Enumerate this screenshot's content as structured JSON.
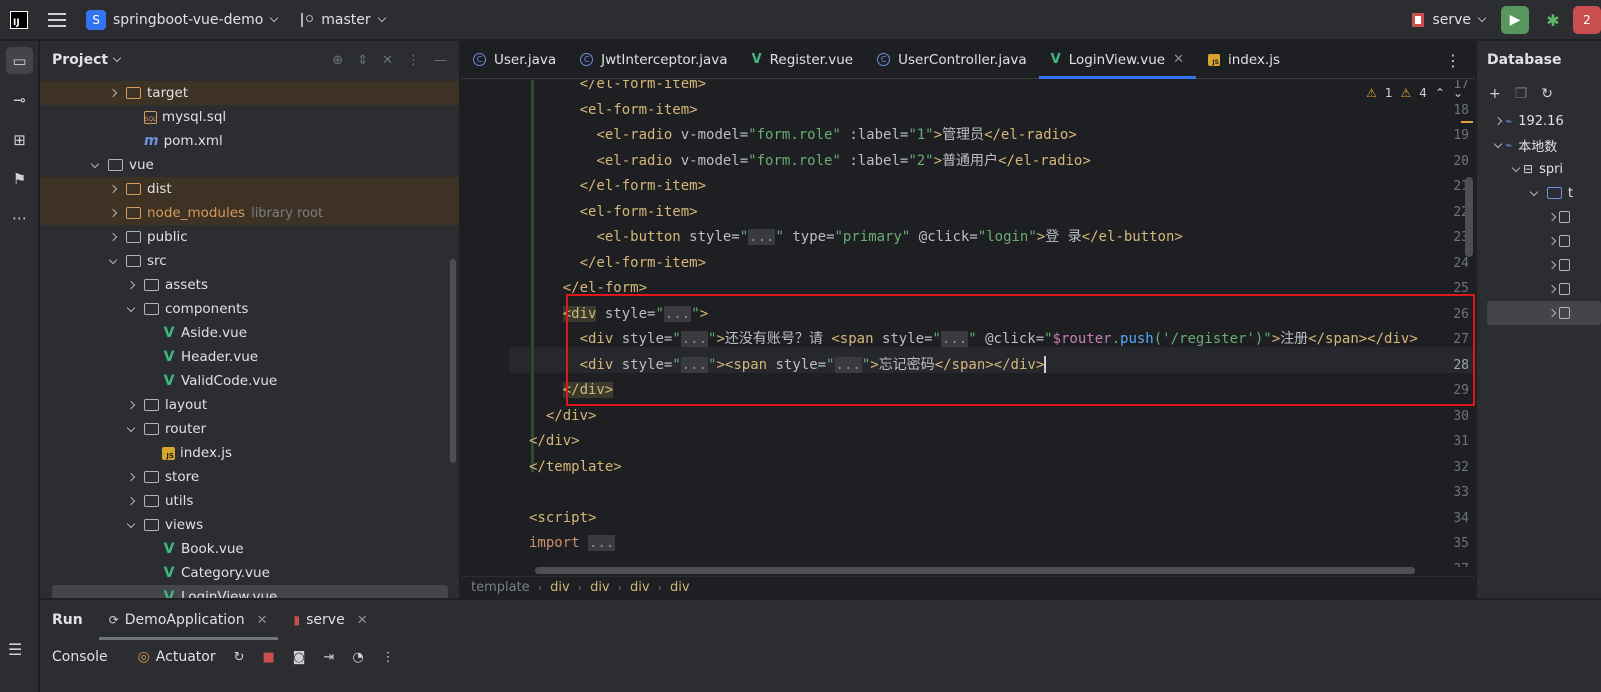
{
  "titlebar": {
    "logo_text": "IJ",
    "project_badge": "S",
    "project_name": "springboot-vue-demo",
    "branch": "master",
    "run_config": "serve",
    "run_icon": "▶",
    "debug_icon": "✱",
    "stop_badge": "2"
  },
  "toolstrip": {
    "icons": [
      "folder-icon",
      "commit-icon",
      "structure-icon",
      "bookmark-icon",
      "more-icon"
    ]
  },
  "project": {
    "title": "Project",
    "tree": [
      {
        "label": "target",
        "indent": 1,
        "kind": "folder-orange",
        "arrow": "closed",
        "excluded": true
      },
      {
        "label": "mysql.sql",
        "indent": 2,
        "kind": "sql",
        "arrow": "none",
        "excluded": false
      },
      {
        "label": "pom.xml",
        "indent": 2,
        "kind": "maven",
        "arrow": "none",
        "excluded": false
      },
      {
        "label": "vue",
        "indent": 0,
        "kind": "folder",
        "arrow": "open",
        "excluded": false
      },
      {
        "label": "dist",
        "indent": 1,
        "kind": "folder-orange",
        "arrow": "closed",
        "excluded": true
      },
      {
        "label": "node_modules",
        "extra": "library root",
        "indent": 1,
        "kind": "folder-orange",
        "arrow": "closed",
        "excluded": true,
        "dim": true
      },
      {
        "label": "public",
        "indent": 1,
        "kind": "folder",
        "arrow": "closed",
        "excluded": false
      },
      {
        "label": "src",
        "indent": 1,
        "kind": "folder",
        "arrow": "open",
        "excluded": false
      },
      {
        "label": "assets",
        "indent": 2,
        "kind": "folder",
        "arrow": "closed",
        "excluded": false
      },
      {
        "label": "components",
        "indent": 2,
        "kind": "folder",
        "arrow": "open",
        "excluded": false
      },
      {
        "label": "Aside.vue",
        "indent": 3,
        "kind": "vue",
        "arrow": "none",
        "excluded": false
      },
      {
        "label": "Header.vue",
        "indent": 3,
        "kind": "vue",
        "arrow": "none",
        "excluded": false
      },
      {
        "label": "ValidCode.vue",
        "indent": 3,
        "kind": "vue",
        "arrow": "none",
        "excluded": false
      },
      {
        "label": "layout",
        "indent": 2,
        "kind": "folder",
        "arrow": "closed",
        "excluded": false
      },
      {
        "label": "router",
        "indent": 2,
        "kind": "folder",
        "arrow": "open",
        "excluded": false
      },
      {
        "label": "index.js",
        "indent": 3,
        "kind": "js",
        "arrow": "none",
        "excluded": false
      },
      {
        "label": "store",
        "indent": 2,
        "kind": "folder",
        "arrow": "closed",
        "excluded": false
      },
      {
        "label": "utils",
        "indent": 2,
        "kind": "folder",
        "arrow": "closed",
        "excluded": false
      },
      {
        "label": "views",
        "indent": 2,
        "kind": "folder",
        "arrow": "open",
        "excluded": false
      },
      {
        "label": "Book.vue",
        "indent": 3,
        "kind": "vue",
        "arrow": "none",
        "excluded": false
      },
      {
        "label": "Category.vue",
        "indent": 3,
        "kind": "vue",
        "arrow": "none",
        "excluded": false
      },
      {
        "label": "LoginView.vue",
        "indent": 3,
        "kind": "vue",
        "arrow": "none",
        "excluded": false,
        "selected": true
      }
    ]
  },
  "editor": {
    "tabs": [
      {
        "label": "User.java",
        "icon": "class",
        "active": false
      },
      {
        "label": "JwtInterceptor.java",
        "icon": "class",
        "active": false
      },
      {
        "label": "Register.vue",
        "icon": "vue",
        "active": false
      },
      {
        "label": "UserController.java",
        "icon": "class",
        "active": false
      },
      {
        "label": "LoginView.vue",
        "icon": "vue",
        "active": true,
        "closable": true
      },
      {
        "label": "index.js",
        "icon": "js",
        "active": false
      }
    ],
    "inspections": {
      "warnings": "1",
      "weak_warnings": "4"
    },
    "current_line": 28,
    "lines": [
      {
        "n": "17",
        "html": "      <span class='t'>&lt;/el-form-item&gt;</span>"
      },
      {
        "n": "18",
        "html": "      <span class='t'>&lt;el-form-item&gt;</span>"
      },
      {
        "n": "19",
        "html": "        <span class='t'>&lt;el-radio </span><span class='a'>v-model=</span><span class='s'>\"form.role\"</span><span class='a'> :label=</span><span class='s'>\"1\"</span><span class='t'>&gt;</span><span class='d'>管理员</span><span class='t'>&lt;/el-radio&gt;</span>"
      },
      {
        "n": "20",
        "html": "        <span class='t'>&lt;el-radio </span><span class='a'>v-model=</span><span class='s'>\"form.role\"</span><span class='a'> :label=</span><span class='s'>\"2\"</span><span class='t'>&gt;</span><span class='d'>普通用户</span><span class='t'>&lt;/el-radio&gt;</span>"
      },
      {
        "n": "21",
        "html": "      <span class='t'>&lt;/el-form-item&gt;</span>"
      },
      {
        "n": "22",
        "html": "      <span class='t'>&lt;el-form-item&gt;</span>"
      },
      {
        "n": "23",
        "html": "        <span class='t'>&lt;el-button </span><span class='a'>style=</span><span class='s'>\"<span class='fold-box'>...</span>\"</span><span class='a'> type=</span><span class='s'>\"primary\"</span><span class='a'> @click=</span><span class='s'>\"login\"</span><span class='t'>&gt;</span><span class='d'>登 录</span><span class='t'>&lt;/el-button&gt;</span>"
      },
      {
        "n": "24",
        "html": "      <span class='t'>&lt;/el-form-item&gt;</span>"
      },
      {
        "n": "25",
        "html": "    <span class='t'>&lt;/el-form&gt;</span>"
      },
      {
        "n": "26",
        "html": "    <span class='t tag-hl'>&lt;div</span><span class='a'> style=</span><span class='s'>\"<span class='fold-box'>...</span>\"</span><span class='t'>&gt;</span>"
      },
      {
        "n": "27",
        "html": "      <span class='t'>&lt;div </span><span class='a'>style=</span><span class='s'>\"<span class='fold-box'>...</span>\"</span><span class='t'>&gt;</span><span class='d'>还没有账号？请 </span><span class='t'>&lt;span </span><span class='a'>style=</span><span class='s'>\"<span class='fold-box'>...</span>\"</span><span class='a'> @click=</span><span class='s'>\"</span><span class='pur'>$router</span><span class='s'>.</span><span class='blu'>push</span><span class='s'>('/register')\"</span><span class='t'>&gt;</span><span class='d'>注册</span><span class='t'>&lt;/span&gt;&lt;/div&gt;</span>"
      },
      {
        "n": "28",
        "html": "      <span class='t'>&lt;div </span><span class='a'>style=</span><span class='s'>\"<span class='fold-box'>...</span>\"</span><span class='t'>&gt;&lt;span </span><span class='a'>style=</span><span class='s'>\"<span class='fold-box'>...</span>\"</span><span class='t'>&gt;</span><span class='d'>忘记密码</span><span class='t'>&lt;/span&gt;&lt;/div&gt;</span><span class='caret'></span>"
      },
      {
        "n": "29",
        "html": "    <span class='t tag-hl'>&lt;/div&gt;</span>"
      },
      {
        "n": "30",
        "html": "  <span class='t'>&lt;/div&gt;</span>"
      },
      {
        "n": "31",
        "html": "<span class='t'>&lt;/div&gt;</span>"
      },
      {
        "n": "32",
        "html": "<span class='t'>&lt;/template&gt;</span>"
      },
      {
        "n": "33",
        "html": ""
      },
      {
        "n": "34",
        "html": "<span class='t'>&lt;script&gt;</span>"
      },
      {
        "n": "35",
        "html": "<span class='k'>import </span><span class='fold-box'>...</span>"
      },
      {
        "n": "37",
        "html": ""
      }
    ],
    "breadcrumbs": [
      "template",
      "div",
      "div",
      "div",
      "div"
    ]
  },
  "database": {
    "title": "Database",
    "rows": [
      {
        "label": "192.16",
        "indent": 0,
        "icon": "datasource"
      },
      {
        "label": "本地数",
        "indent": 0,
        "icon": "datasource"
      },
      {
        "label": "spri",
        "indent": 1,
        "icon": "schema"
      },
      {
        "label": "t",
        "indent": 2,
        "icon": "folder"
      },
      {
        "label": "",
        "indent": 3,
        "icon": "table"
      },
      {
        "label": "",
        "indent": 3,
        "icon": "table"
      },
      {
        "label": "",
        "indent": 3,
        "icon": "table"
      },
      {
        "label": "",
        "indent": 3,
        "icon": "table"
      },
      {
        "label": "",
        "indent": 3,
        "icon": "table",
        "selected": true
      }
    ]
  },
  "bottom": {
    "run_label": "Run",
    "run_tabs": [
      {
        "label": "DemoApplication",
        "active": true
      },
      {
        "label": "serve",
        "active": false
      }
    ],
    "console_label": "Console",
    "actuator_label": "Actuator"
  },
  "colors": {
    "accent": "#3574f0",
    "highlight_box": "#e0161b",
    "vue_green": "#42b883"
  }
}
